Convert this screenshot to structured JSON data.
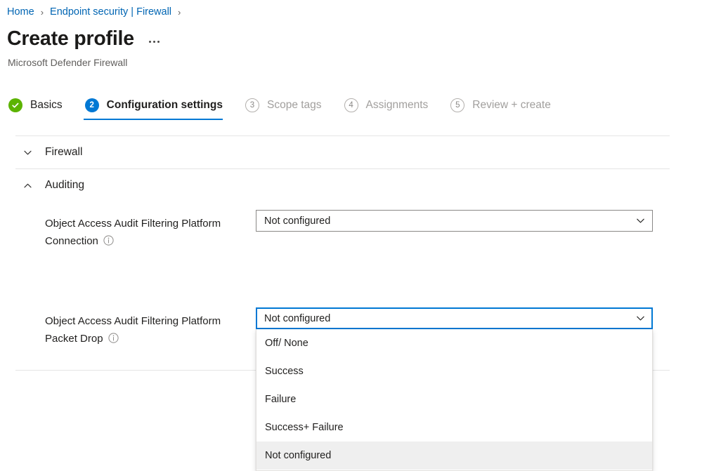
{
  "breadcrumb": {
    "items": [
      {
        "label": "Home"
      },
      {
        "label": "Endpoint security | Firewall"
      }
    ],
    "separator": "›"
  },
  "header": {
    "title": "Create profile",
    "subtitle": "Microsoft Defender Firewall",
    "more_actions": "…"
  },
  "wizard": {
    "tabs": [
      {
        "step": "✓",
        "label": "Basics",
        "state": "done"
      },
      {
        "step": "2",
        "label": "Configuration settings",
        "state": "active"
      },
      {
        "step": "3",
        "label": "Scope tags",
        "state": "idle"
      },
      {
        "step": "4",
        "label": "Assignments",
        "state": "idle"
      },
      {
        "step": "5",
        "label": "Review + create",
        "state": "idle"
      }
    ]
  },
  "sections": [
    {
      "label": "Firewall",
      "expanded": false
    },
    {
      "label": "Auditing",
      "expanded": true
    }
  ],
  "settings": [
    {
      "label": "Object Access Audit Filtering Platform Connection",
      "info": "i",
      "value": "Not configured",
      "focused": false,
      "open": false
    },
    {
      "label": "Object Access Audit Filtering Platform Packet Drop",
      "info": "i",
      "value": "Not configured",
      "focused": true,
      "open": true
    }
  ],
  "dropdown_options": [
    {
      "label": "Off/ None",
      "selected": false
    },
    {
      "label": "Success",
      "selected": false
    },
    {
      "label": "Failure",
      "selected": false
    },
    {
      "label": "Success+ Failure",
      "selected": false
    },
    {
      "label": "Not configured",
      "selected": true
    }
  ],
  "colors": {
    "link": "#0065b3",
    "accent": "#0078d4",
    "success": "#5cb300",
    "divider": "#e5e5e5",
    "highlight": "#efefef"
  }
}
